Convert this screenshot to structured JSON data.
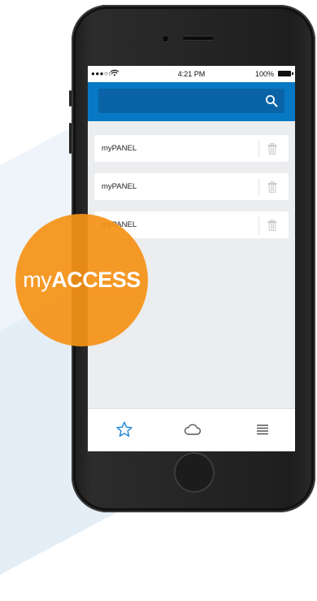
{
  "statusbar": {
    "signal": "●●●○○",
    "time": "4:21 PM",
    "battery": "100%"
  },
  "header": {
    "search_icon": "search-icon"
  },
  "panels": [
    {
      "label": "myPANEL"
    },
    {
      "label": "myPANEL"
    },
    {
      "label": "myPANEL"
    }
  ],
  "tabbar": {
    "items": [
      {
        "icon": "star-icon",
        "active": true
      },
      {
        "icon": "cloud-icon",
        "active": false
      },
      {
        "icon": "menu-icon",
        "active": false
      }
    ]
  },
  "badge": {
    "prefix": "my",
    "bold": "ACCESS"
  },
  "colors": {
    "header_blue": "#0779c4",
    "search_blue": "#0a63a6",
    "accent_orange": "#f59217",
    "tab_active": "#2a8bd6"
  }
}
